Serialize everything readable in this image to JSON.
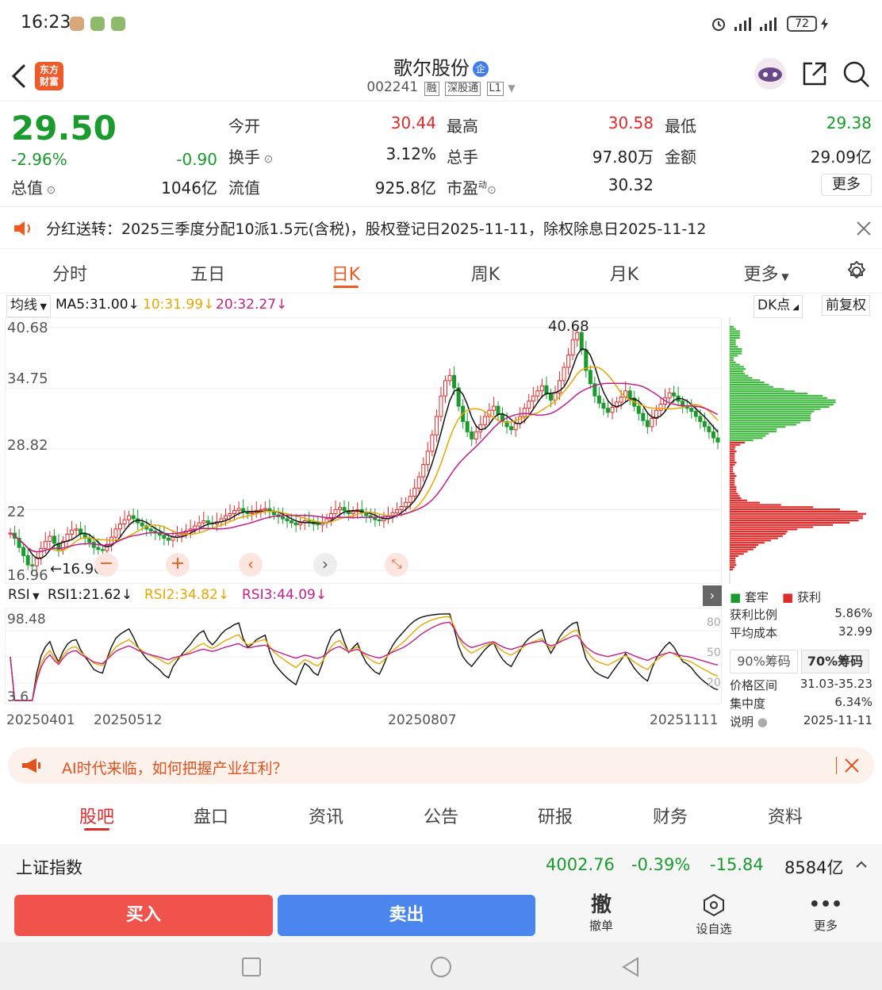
{
  "status": {
    "time": "16:23",
    "battery": "72"
  },
  "header": {
    "logo_text_1": "东方",
    "logo_text_2": "财富",
    "stock_name": "歌尔股份",
    "badge": "企",
    "code": "002241",
    "tag_rong": "融",
    "tag_sgt": "深股通",
    "tag_l1": "L1"
  },
  "quote": {
    "price": "29.50",
    "change_pct": "-2.96%",
    "change": "-0.90",
    "total_value_label": "总值",
    "total_value": "1046亿",
    "open_label": "今开",
    "open": "30.44",
    "high_label": "最高",
    "high": "30.58",
    "low_label": "最低",
    "low": "29.38",
    "turnover_label": "换手",
    "turnover": "3.12%",
    "volume_label": "总手",
    "volume": "97.80万",
    "amount_label": "金额",
    "amount": "29.09亿",
    "float_label": "流值",
    "float_value": "925.8亿",
    "pe_label": "市盈",
    "pe_sup": "动",
    "pe": "30.32",
    "more": "更多"
  },
  "dividend": {
    "text": "分红送转：2025三季度分配10派1.5元(含税)，股权登记日2025-11-11，除权除息日2025-11-12"
  },
  "tabs": [
    "分时",
    "五日",
    "日K",
    "周K",
    "月K",
    "更多"
  ],
  "ma": {
    "selector": "均线",
    "ma5": "MA5:31.00",
    "ma10": "10:31.99",
    "ma20": "20:32.27",
    "dk": "DK点",
    "fq": "前复权",
    "colors": {
      "ma5": "#111111",
      "ma10": "#e6a700",
      "ma20": "#c0208a",
      "up": "#e02a2a",
      "down": "#1a9b2d"
    }
  },
  "chart_data": {
    "type": "candlestick",
    "y_ticks": [
      "40.68",
      "34.75",
      "28.82",
      "22.89",
      "16.96"
    ],
    "y_ticks_display": [
      "40.68",
      "34.75",
      "28.82",
      "22",
      "16.96"
    ],
    "ylim": [
      16.96,
      40.68
    ],
    "x_ticks": [
      "20250401",
      "20250512",
      "20250807",
      "20251111"
    ],
    "annotations": {
      "max_label": "40.68",
      "min_label": "16.96"
    },
    "closes": [
      20.6,
      20.1,
      19.2,
      18.4,
      17.5,
      17.4,
      18.2,
      19.1,
      19.8,
      20.3,
      19.6,
      19.0,
      19.8,
      20.5,
      20.9,
      21.0,
      20.5,
      20.1,
      19.7,
      19.2,
      19.0,
      18.9,
      19.5,
      20.2,
      21.0,
      21.5,
      21.9,
      22.3,
      22.0,
      21.6,
      21.3,
      21.0,
      20.8,
      20.6,
      20.4,
      20.1,
      19.9,
      20.2,
      20.4,
      20.6,
      20.8,
      21.0,
      21.3,
      21.6,
      21.8,
      21.6,
      21.5,
      21.7,
      22.0,
      22.3,
      22.5,
      22.8,
      23.0,
      22.7,
      22.5,
      22.6,
      22.8,
      22.9,
      23.0,
      22.7,
      22.4,
      22.2,
      22.0,
      21.8,
      21.6,
      21.4,
      21.6,
      21.8,
      21.7,
      21.5,
      21.4,
      21.6,
      22.0,
      22.5,
      22.9,
      23.1,
      22.8,
      22.5,
      22.7,
      22.9,
      22.6,
      22.3,
      22.1,
      21.9,
      21.8,
      22.0,
      22.3,
      22.6,
      22.9,
      23.2,
      23.6,
      24.2,
      25.0,
      26.1,
      27.3,
      28.6,
      30.2,
      32.0,
      34.0,
      35.5,
      36.0,
      34.8,
      33.0,
      31.5,
      30.5,
      29.8,
      30.5,
      31.2,
      32.0,
      32.6,
      33.0,
      32.2,
      31.5,
      31.0,
      30.7,
      31.3,
      32.0,
      32.8,
      33.5,
      34.0,
      34.5,
      35.0,
      34.2,
      33.6,
      34.3,
      35.5,
      36.8,
      38.0,
      39.5,
      40.2,
      38.5,
      36.5,
      35.2,
      34.0,
      33.3,
      32.8,
      32.4,
      32.9,
      33.4,
      33.9,
      34.5,
      33.8,
      33.0,
      32.3,
      31.6,
      31.0,
      31.8,
      32.6,
      33.2,
      33.8,
      34.3,
      34.0,
      33.5,
      33.0,
      32.8,
      32.5,
      32.0,
      31.5,
      31.0,
      30.5,
      29.9,
      29.5
    ],
    "rsi": {
      "selector": "RSI",
      "rsi1": "RSI1:21.62",
      "rsi2": "RSI2:34.82",
      "rsi3": "RSI3:44.09",
      "y_ticks_left": [
        "98.48",
        "3.67"
      ],
      "y_ticks_display_left": [
        "98.48",
        "3.6"
      ],
      "y_ticks_right": [
        "80",
        "50",
        "20"
      ],
      "colors": {
        "rsi1": "#111111",
        "rsi2": "#e6a700",
        "rsi3": "#c0208a"
      }
    }
  },
  "chip": {
    "legend_trap": "套牢",
    "legend_profit": "获利",
    "profit_ratio_label": "获利比例",
    "profit_ratio": "5.86%",
    "avg_cost_label": "平均成本",
    "avg_cost": "32.99",
    "btn_90": "90%筹码",
    "btn_70": "70%筹码",
    "price_range_label": "价格区间",
    "price_range": "31.03-35.23",
    "concentration_label": "集中度",
    "concentration": "6.34%",
    "note_label": "说明",
    "date": "2025-11-11"
  },
  "ai_banner": {
    "text": "AI时代来临，如何把握产业红利？"
  },
  "bottom_tabs": [
    "股吧",
    "盘口",
    "资讯",
    "公告",
    "研报",
    "财务",
    "资料"
  ],
  "index": {
    "name": "上证指数",
    "value": "4002.76",
    "pct": "-0.39%",
    "change": "-15.84",
    "amount": "8584亿"
  },
  "actions": {
    "buy": "买入",
    "sell": "卖出",
    "cancel_icon": "撤",
    "cancel": "撤单",
    "watch": "设自选",
    "more": "更多"
  }
}
